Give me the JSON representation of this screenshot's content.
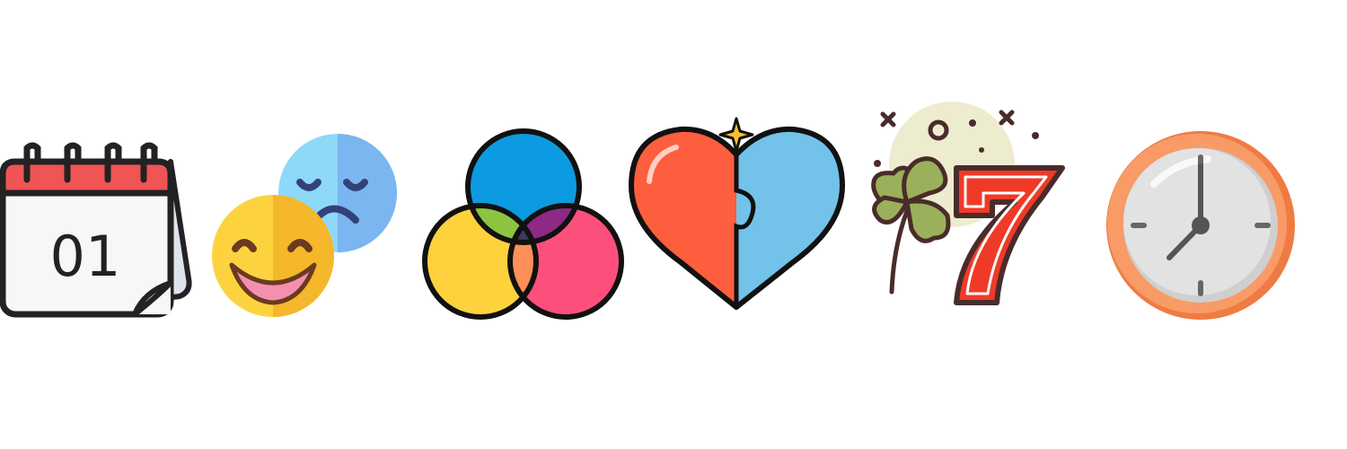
{
  "icons": [
    {
      "name": "calendar-icon",
      "text": "01",
      "colors": {
        "header": "#f05454",
        "body": "#f7f7f7",
        "outline": "#222222"
      }
    },
    {
      "name": "happy-sad-emoji-icon",
      "colors": {
        "happy": "#fcd33f",
        "happy_shade": "#f5b72b",
        "sad": "#8ed8f8",
        "sad_shade": "#7bb6f0",
        "mouth": "#f58fb0"
      }
    },
    {
      "name": "color-venn-icon",
      "colors": {
        "blue": "#0c9be0",
        "yellow": "#fdd23d",
        "pink": "#fd4f7b",
        "green": "#8cc43f",
        "purple": "#8e2a84",
        "orange": "#fd8f5a"
      }
    },
    {
      "name": "puzzle-heart-icon",
      "colors": {
        "left": "#fd5e3d",
        "right": "#72c2ea",
        "outline": "#111111",
        "sparkle": "#f9c22b"
      }
    },
    {
      "name": "lucky-seven-clover-icon",
      "text": "7",
      "colors": {
        "seven": "#f03a28",
        "clover": "#9bb05a",
        "outline": "#4a2b2b",
        "background": "#eeeccf"
      }
    },
    {
      "name": "wall-clock-icon",
      "colors": {
        "rim": "#f89b66",
        "rim_dark": "#ef7b43",
        "face": "#dedede",
        "hands": "#555555"
      }
    }
  ]
}
